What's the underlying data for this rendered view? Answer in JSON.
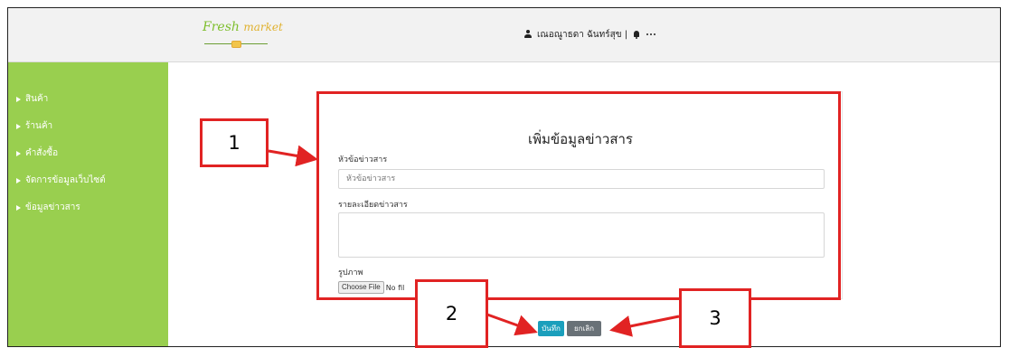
{
  "header": {
    "brand": {
      "fresh": "Fresh",
      "market": "market"
    },
    "user_name": "เณอณูาธดา ฉันทร์สุข |"
  },
  "sidebar": {
    "items": [
      {
        "label": "สินค้า"
      },
      {
        "label": "ร้านค้า"
      },
      {
        "label": "คำสั่งซื้อ"
      },
      {
        "label": "จัดการข้อมูลเว็บไซต์"
      },
      {
        "label": "ข้อมูลข่าวสาร"
      }
    ]
  },
  "form": {
    "title": "เพิ่มข้อมูลข่าวสาร",
    "headline_label": "หัวข้อข่าวสาร",
    "headline_placeholder": "หัวข้อข่าวสาร",
    "detail_label": "รายละเอียดข่าวสาร",
    "image_label": "รูปภาพ",
    "file_button": "Choose File",
    "file_status": "No fil"
  },
  "actions": {
    "save": "บันทึก",
    "cancel": "ยกเลิก"
  },
  "annotations": {
    "one": "1",
    "two": "2",
    "three": "3"
  }
}
